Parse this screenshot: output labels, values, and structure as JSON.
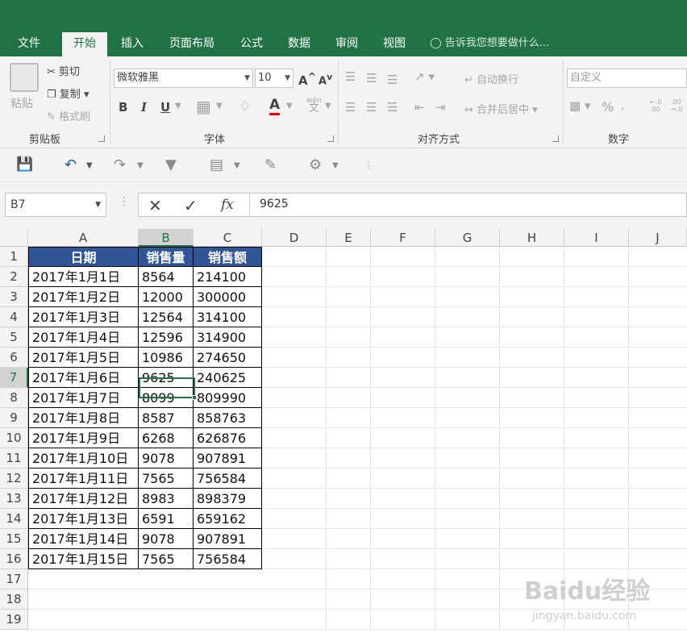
{
  "tabs": [
    "文件",
    "开始",
    "插入",
    "页面布局",
    "公式",
    "数据",
    "审阅",
    "视图"
  ],
  "active_tab": "开始",
  "tell_me": "告诉我您想要做什么...",
  "clipboard": {
    "paste": "粘贴",
    "cut": "剪切",
    "copy": "复制",
    "format_painter": "格式刷",
    "label": "剪贴板"
  },
  "font": {
    "name": "微软雅黑",
    "size": "10",
    "bold": "B",
    "italic": "I",
    "underline": "U",
    "label": "字体",
    "grow": "A",
    "shrink": "A",
    "wen": "wén",
    "wen2": "文"
  },
  "alignment": {
    "wrap": "自动换行",
    "merge": "合并后居中",
    "label": "对齐方式"
  },
  "number": {
    "format": "自定义",
    "percent": "%",
    "label": "数字"
  },
  "namebox": "B7",
  "formula": "9625",
  "fx": "fx",
  "columns": [
    "A",
    "B",
    "C",
    "D",
    "E",
    "F",
    "G",
    "H",
    "I",
    "J"
  ],
  "rows": [
    "1",
    "2",
    "3",
    "4",
    "5",
    "6",
    "7",
    "8",
    "9",
    "10",
    "11",
    "12",
    "13",
    "14",
    "15",
    "16",
    "17",
    "18",
    "19"
  ],
  "table": {
    "headers": [
      "日期",
      "销售量",
      "销售额"
    ],
    "rows": [
      [
        "2017年1月1日",
        "8564",
        "214100"
      ],
      [
        "2017年1月2日",
        "12000",
        "300000"
      ],
      [
        "2017年1月3日",
        "12564",
        "314100"
      ],
      [
        "2017年1月4日",
        "12596",
        "314900"
      ],
      [
        "2017年1月5日",
        "10986",
        "274650"
      ],
      [
        "2017年1月6日",
        "9625",
        "240625"
      ],
      [
        "2017年1月7日",
        "8099",
        "809990"
      ],
      [
        "2017年1月8日",
        "8587",
        "858763"
      ],
      [
        "2017年1月9日",
        "6268",
        "626876"
      ],
      [
        "2017年1月10日",
        "9078",
        "907891"
      ],
      [
        "2017年1月11日",
        "7565",
        "756584"
      ],
      [
        "2017年1月12日",
        "8983",
        "898379"
      ],
      [
        "2017年1月13日",
        "6591",
        "659162"
      ],
      [
        "2017年1月14日",
        "9078",
        "907891"
      ],
      [
        "2017年1月15日",
        "7565",
        "756584"
      ]
    ]
  },
  "watermark": {
    "brand": "Baidu经验",
    "url": "jingyan.baidu.com"
  },
  "colors": {
    "excel_green": "#217346",
    "header_blue": "#2f5597"
  }
}
